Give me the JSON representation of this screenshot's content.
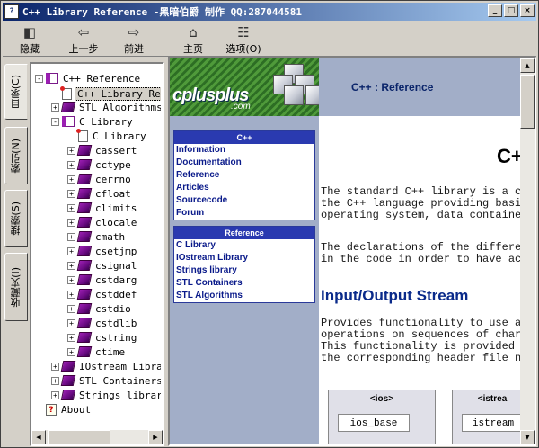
{
  "window": {
    "title": "C++ Library Reference -黑暗伯爵 制作 QQ:287044581",
    "icon": "?",
    "minimize": "_",
    "maximize": "□",
    "close": "×"
  },
  "toolbar": [
    {
      "label": "隐藏",
      "icon": "hide-icon"
    },
    {
      "label": "上一步",
      "icon": "back-arrow-icon"
    },
    {
      "label": "前进",
      "icon": "forward-arrow-icon"
    },
    {
      "label": "主页",
      "icon": "home-icon"
    },
    {
      "label": "选项(O)",
      "icon": "options-icon"
    }
  ],
  "tabs": [
    "目录(C)",
    "索引(N)",
    "搜索(S)",
    "收藏夹(I)"
  ],
  "tree": [
    {
      "label": "C++ Reference",
      "icon": "book-open",
      "expander": "-"
    },
    {
      "label": "C++ Library Reference",
      "icon": "page",
      "selected": true
    },
    {
      "label": "STL Algorithms",
      "icon": "book-closed",
      "expander": "+"
    },
    {
      "label": "C Library",
      "icon": "book-open",
      "expander": "-"
    },
    {
      "label": "C Library",
      "icon": "page"
    },
    {
      "label": "cassert",
      "icon": "book-closed",
      "expander": "+"
    },
    {
      "label": "cctype",
      "icon": "book-closed",
      "expander": "+"
    },
    {
      "label": "cerrno",
      "icon": "book-closed",
      "expander": "+"
    },
    {
      "label": "cfloat",
      "icon": "book-closed",
      "expander": "+"
    },
    {
      "label": "climits",
      "icon": "book-closed",
      "expander": "+"
    },
    {
      "label": "clocale",
      "icon": "book-closed",
      "expander": "+"
    },
    {
      "label": "cmath",
      "icon": "book-closed",
      "expander": "+"
    },
    {
      "label": "csetjmp",
      "icon": "book-closed",
      "expander": "+"
    },
    {
      "label": "csignal",
      "icon": "book-closed",
      "expander": "+"
    },
    {
      "label": "cstdarg",
      "icon": "book-closed",
      "expander": "+"
    },
    {
      "label": "cstddef",
      "icon": "book-closed",
      "expander": "+"
    },
    {
      "label": "cstdio",
      "icon": "book-closed",
      "expander": "+"
    },
    {
      "label": "cstdlib",
      "icon": "book-closed",
      "expander": "+"
    },
    {
      "label": "cstring",
      "icon": "book-closed",
      "expander": "+"
    },
    {
      "label": "ctime",
      "icon": "book-closed",
      "expander": "+"
    },
    {
      "label": "IOstream Library",
      "icon": "book-closed",
      "expander": "+"
    },
    {
      "label": "STL Containers",
      "icon": "book-closed",
      "expander": "+"
    },
    {
      "label": "Strings library",
      "icon": "book-closed",
      "expander": "+"
    },
    {
      "label": "About",
      "icon": "help"
    }
  ],
  "page": {
    "logo": "cplusplus",
    "logo_domain": ".com",
    "breadcrumb": "C++ : Reference",
    "nav_cpp": {
      "header": "C++",
      "items": [
        "Information",
        "Documentation",
        "Reference",
        "Articles",
        "Sourcecode",
        "Forum"
      ]
    },
    "nav_ref": {
      "header": "Reference",
      "items": [
        "C Library",
        "IOstream Library",
        "Strings library",
        "STL Containers",
        "STL Algorithms"
      ]
    },
    "big_title": "C+",
    "intro": "The standard C++ library is a collec\nthe C++ language providing basic fu\noperating system, data containers,",
    "decl": "The declarations of the different ele\nin the code in order to have access",
    "section_title": "Input/Output Stream",
    "section_text": "Provides functionality to use an abs\noperations on sequences of charact\nThis functionality is provided throug\nthe corresponding header file name",
    "diagram": [
      {
        "header": "<ios>",
        "item": "ios_base"
      },
      {
        "header": "<istrea",
        "item": "istream"
      }
    ]
  },
  "colors": {
    "title_bar": "#0a246a",
    "nav_bg": "#a2aec8",
    "link": "#0a1a8a",
    "heading": "#0a2a8a",
    "book": "#9b1fb2"
  }
}
